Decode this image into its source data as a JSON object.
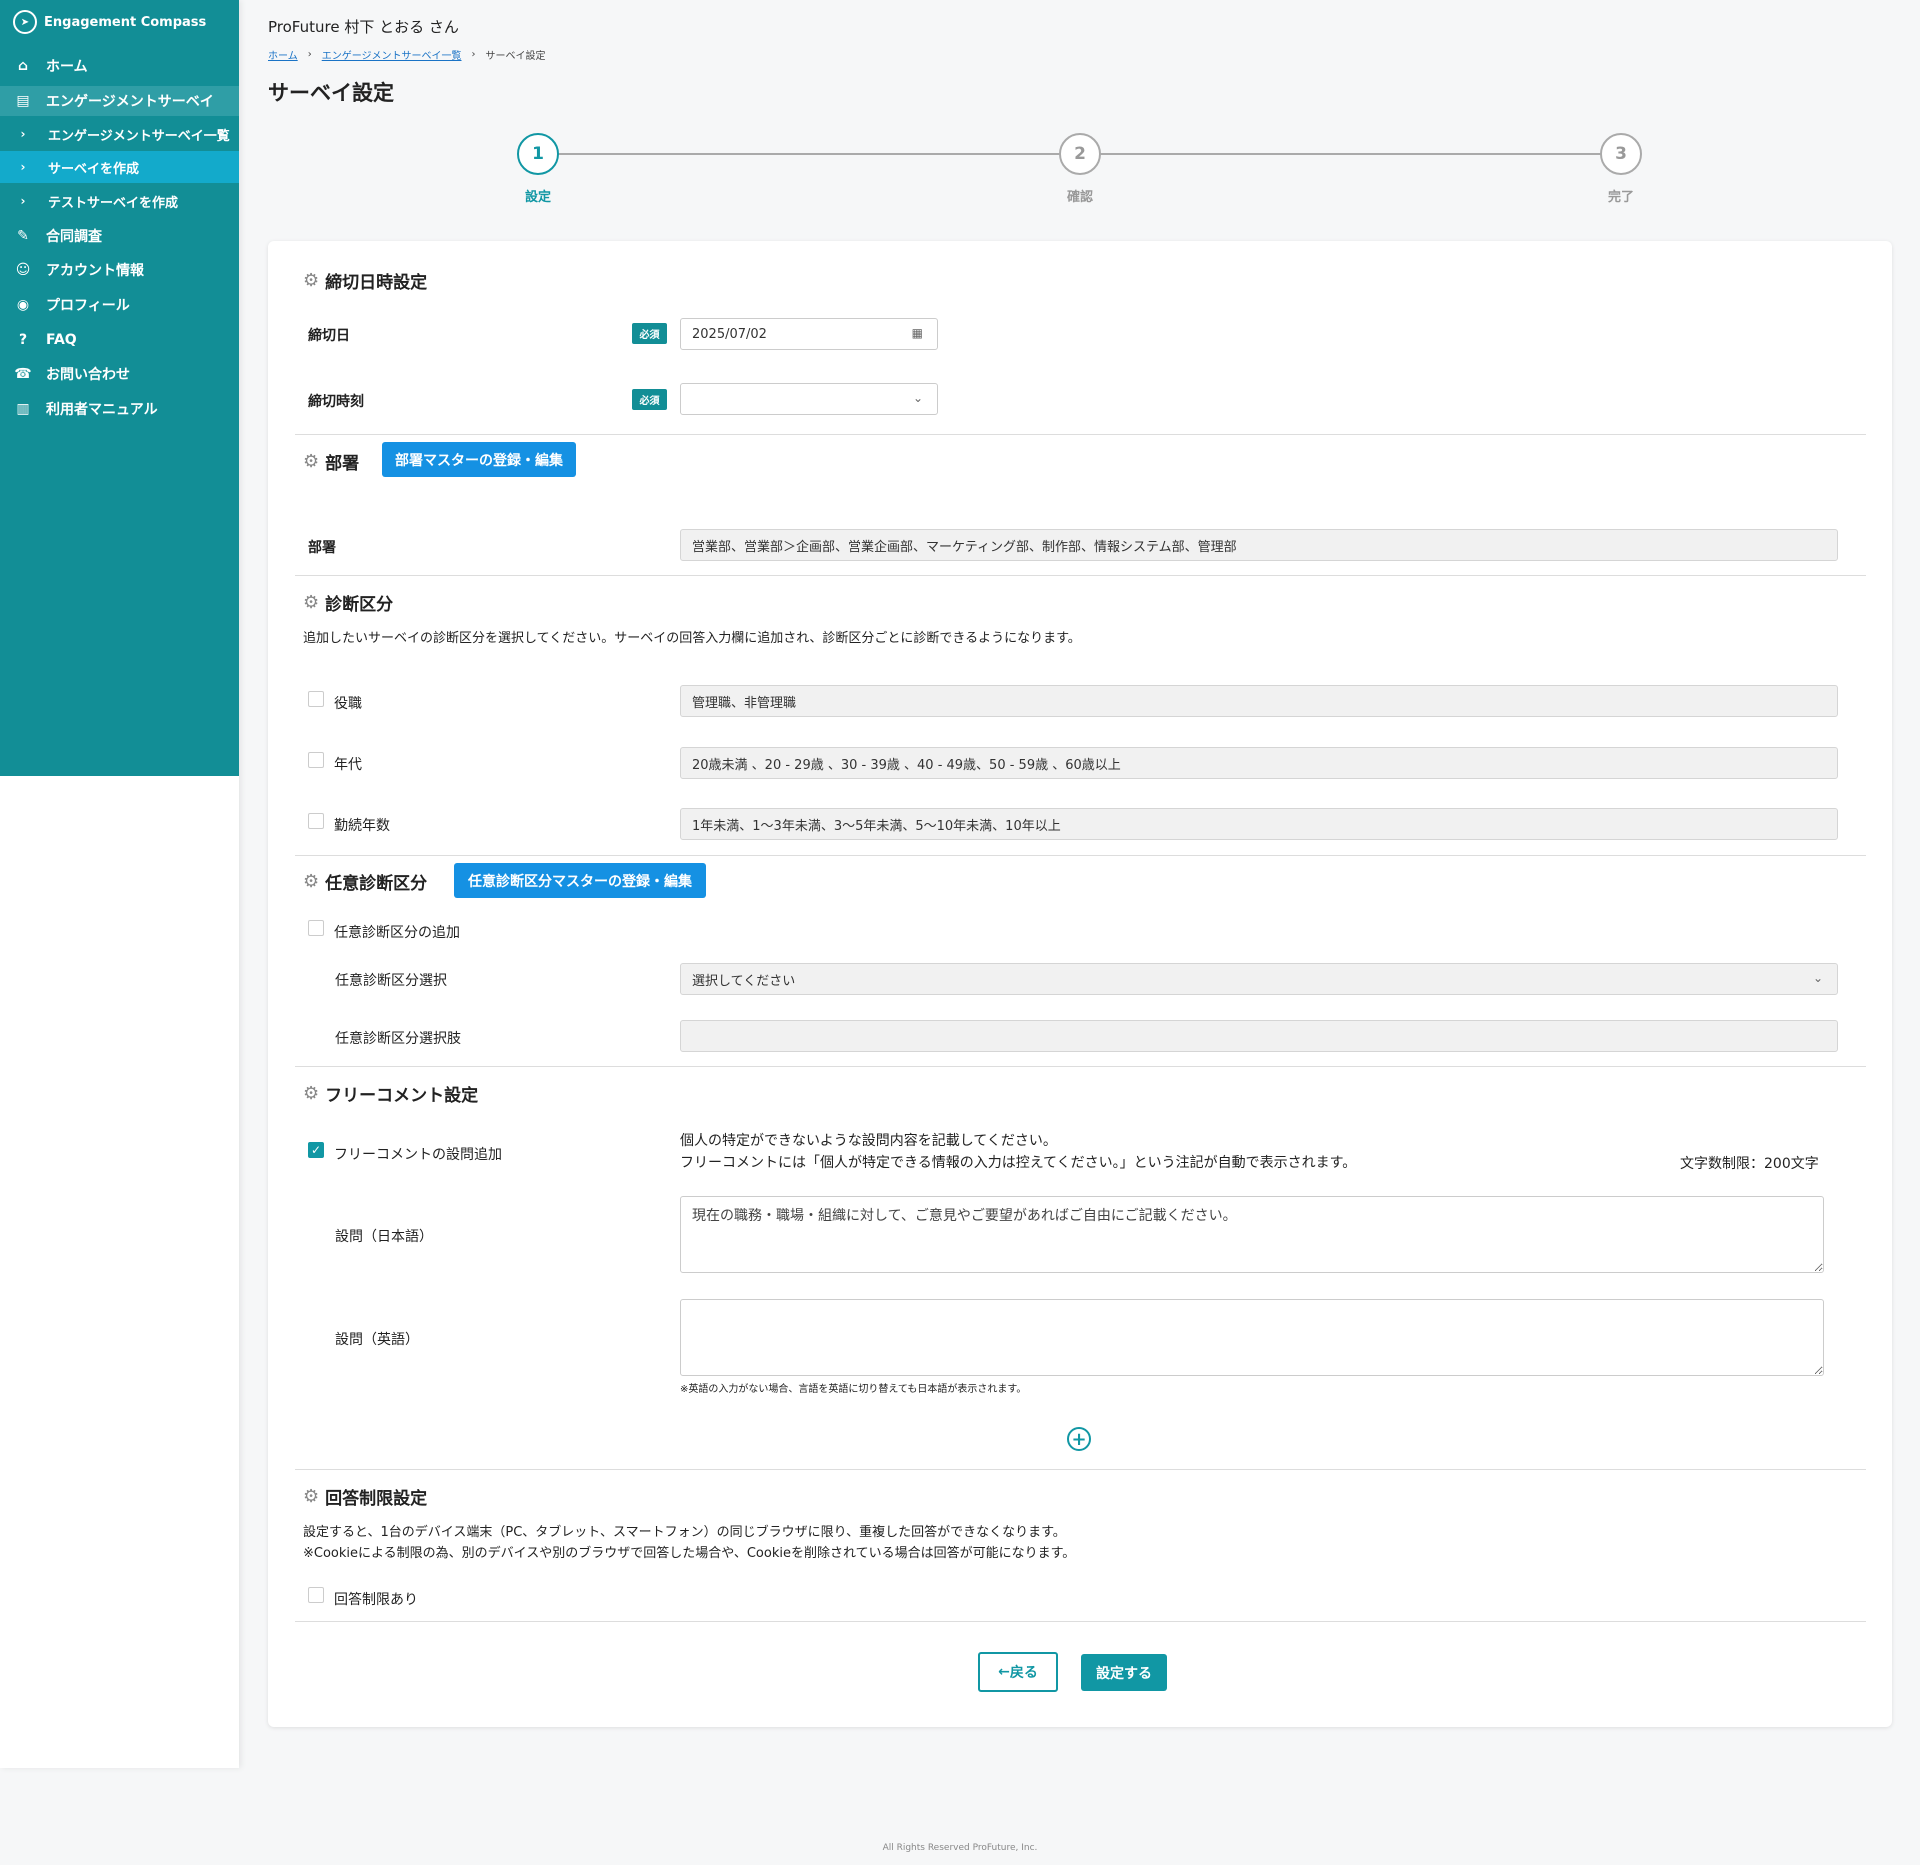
{
  "app": {
    "name": "Engagement Compass"
  },
  "sidebar": {
    "items": [
      {
        "label": "ホーム",
        "icon": "home-icon"
      },
      {
        "label": "エンゲージメントサーベイ",
        "icon": "survey-icon"
      },
      {
        "label": "エンゲージメントサーベイ一覧",
        "icon": "chevron-right-icon"
      },
      {
        "label": "サーベイを作成",
        "icon": "chevron-right-icon"
      },
      {
        "label": "テストサーベイを作成",
        "icon": "chevron-right-icon"
      },
      {
        "label": "合同調査",
        "icon": "document-icon"
      },
      {
        "label": "アカウント情報",
        "icon": "account-icon"
      },
      {
        "label": "プロフィール",
        "icon": "profile-icon"
      },
      {
        "label": "FAQ",
        "icon": "help-icon"
      },
      {
        "label": "お問い合わせ",
        "icon": "phone-icon"
      },
      {
        "label": "利用者マニュアル",
        "icon": "manual-icon"
      }
    ]
  },
  "header": {
    "user": "ProFuture 村下 とおる さん"
  },
  "breadcrumb": {
    "home": "ホーム",
    "list": "エンゲージメントサーベイ一覧",
    "current": "サーベイ設定"
  },
  "page_title": "サーベイ設定",
  "stepper": [
    {
      "num": "1",
      "label": "設定"
    },
    {
      "num": "2",
      "label": "確認"
    },
    {
      "num": "3",
      "label": "完了"
    }
  ],
  "deadline": {
    "title": "締切日時設定",
    "date_label": "締切日",
    "date_value": "2025/07/02",
    "time_label": "締切時刻",
    "time_value": "",
    "required": "必須"
  },
  "department": {
    "title": "部署",
    "master_button": "部署マスターの登録・編集",
    "label": "部署",
    "value": "営業部、営業部＞企画部、営業企画部、マーケティング部、制作部、情報システム部、管理部"
  },
  "diagnosis": {
    "title": "診断区分",
    "description": "追加したいサーベイの診断区分を選択してください。サーベイの回答入力欄に追加され、診断区分ごとに診断できるようになります。",
    "rows": [
      {
        "label": "役職",
        "value": "管理職、非管理職"
      },
      {
        "label": "年代",
        "value": "20歳未満 、20 - 29歳 、30 - 39歳 、40 - 49歳、50 - 59歳 、60歳以上"
      },
      {
        "label": "勤続年数",
        "value": "1年未満、1〜3年未満、3〜5年未満、5〜10年未満、10年以上"
      }
    ]
  },
  "optional": {
    "title": "任意診断区分",
    "master_button": "任意診断区分マスターの登録・編集",
    "add_label": "任意診断区分の追加",
    "select_label": "任意診断区分選択",
    "select_placeholder": "選択してください",
    "options_label": "任意診断区分選択肢",
    "options_value": ""
  },
  "free_comment": {
    "title": "フリーコメント設定",
    "add_label": "フリーコメントの設問追加",
    "note1": "個人の特定ができないような設問内容を記載してください。",
    "note2": "フリーコメントには「個人が特定できる情報の入力は控えてください。」という注記が自動で表示されます。",
    "limit": "文字数制限：200文字",
    "ja_label": "設問（日本語）",
    "ja_value": "現在の職務・職場・組織に対して、ご意見やご要望があればご自由にご記載ください。",
    "en_label": "設問（英語）",
    "en_value": "",
    "en_note": "※英語の入力がない場合、言語を英語に切り替えても日本語が表示されます。"
  },
  "limit": {
    "title": "回答制限設定",
    "desc1": "設定すると、1台のデバイス端末（PC、タブレット、スマートフォン）の同じブラウザに限り、重複した回答ができなくなります。",
    "desc2": "※Cookieによる制限の為、別のデバイスや別のブラウザで回答した場合や、Cookieを削除されている場合は回答が可能になります。",
    "checkbox_label": "回答制限あり"
  },
  "actions": {
    "back": "戻る",
    "save": "設定する"
  },
  "footer": "All Rights Reserved ProFuture, Inc.",
  "colors": {
    "teal": "#128e96",
    "accent": "#1197a4",
    "blue_button": "#1591e3"
  }
}
